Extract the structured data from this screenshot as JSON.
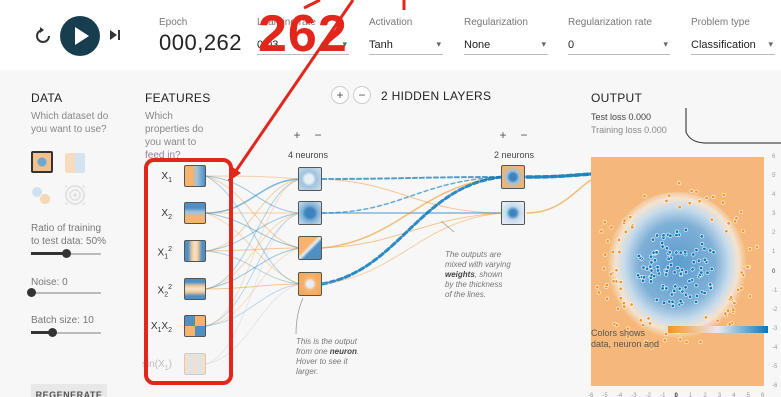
{
  "top": {
    "labels": {
      "epoch": "Epoch",
      "learning_rate": "Learning rate",
      "activation": "Activation",
      "regularization": "Regularization",
      "regularization_rate": "Regularization rate",
      "problem_type": "Problem type"
    },
    "epoch_value": "000,262",
    "learning_rate_value": "0.03",
    "activation_value": "Tanh",
    "regularization_value": "None",
    "regularization_rate_value": "0",
    "problem_type_value": "Classification",
    "controls": {
      "reset_icon": "reset-icon",
      "play_icon": "play-icon",
      "step_icon": "step-forward-icon"
    }
  },
  "overlay": {
    "big_number": "262",
    "color": "#e3261b"
  },
  "data_panel": {
    "title": "DATA",
    "subtitle": "Which dataset do you want to use?",
    "ratio_label": "Ratio of training to test data:  50%",
    "ratio_value": 0.5,
    "noise_label": "Noise:  0",
    "noise_value": 0,
    "batch_label": "Batch size:  10",
    "batch_value": 0.3,
    "regenerate": "REGENERATE"
  },
  "features_panel": {
    "title": "FEATURES",
    "subtitle": "Which properties do you want to feed in?",
    "items": [
      {
        "label": "X",
        "sub": "1",
        "sup": ""
      },
      {
        "label": "X",
        "sub": "2",
        "sup": ""
      },
      {
        "label": "X",
        "sub": "1",
        "sup": "2"
      },
      {
        "label": "X",
        "sub": "2",
        "sup": "2"
      },
      {
        "label": "X",
        "sub": "1",
        "label2": "X",
        "sub2": "2"
      },
      {
        "label": "sin(X",
        "sub": "1",
        "suffix": ")"
      }
    ]
  },
  "network": {
    "hidden_title": "2  HIDDEN LAYERS",
    "layer1_count": "4 neurons",
    "layer2_count": "2 neurons",
    "note_outputs": [
      "The outputs are",
      "mixed with varying",
      "weights",
      ", shown",
      "by the thickness",
      "of the lines."
    ],
    "note_neuron": [
      "This is the output",
      "from one ",
      "neuron",
      ".",
      "Hover to see it",
      "larger."
    ]
  },
  "output_panel": {
    "title": "OUTPUT",
    "test_loss": "Test loss 0.000",
    "training_loss": "Training loss 0.000",
    "y_ticks": [
      "6",
      "5",
      "4",
      "3",
      "2",
      "1",
      "0",
      "-1",
      "-2",
      "-3",
      "-4",
      "-5",
      "-6"
    ],
    "x_ticks": [
      "-6",
      "-5",
      "-4",
      "-3",
      "-2",
      "-1",
      "0",
      "1",
      "2",
      "3",
      "4",
      "5",
      "6"
    ],
    "legend_text": [
      "Colors shows",
      "data, neuron and"
    ]
  },
  "colors": {
    "orange": "#f59322",
    "blue": "#0877bd",
    "dark": "#183d4e",
    "annotation_red": "#e3261b"
  }
}
